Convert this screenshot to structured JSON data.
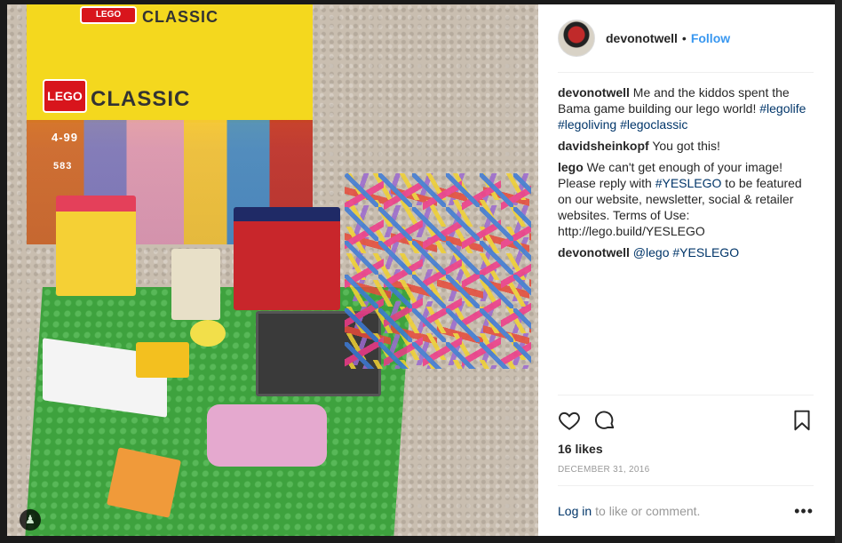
{
  "header": {
    "username": "devonotwell",
    "separator": "•",
    "follow_label": "Follow"
  },
  "photo": {
    "box_brand": "LEGO",
    "box_title": "CLASSIC",
    "box_age": "4-99",
    "box_count": "583",
    "user_icon": "person-tag-icon"
  },
  "comments": [
    {
      "user": "devonotwell",
      "text": "Me and the kiddos spent the Bama game building our lego world! ",
      "tags": [
        "#legolife",
        "#legoliving",
        "#legoclassic"
      ]
    },
    {
      "user": "davidsheinkopf",
      "text": "You got this!"
    },
    {
      "user": "lego",
      "text_before": "We can't get enough of your image! Please reply with ",
      "tag": "#YESLEGO",
      "text_after": " to be featured on our website, newsletter, social & retailer websites. Terms of Use: http://lego.build/YESLEGO"
    },
    {
      "user": "devonotwell",
      "mention": "@lego",
      "tag": "#YESLEGO"
    }
  ],
  "actions": {
    "icons": [
      "heart-icon",
      "comment-icon",
      "bookmark-icon"
    ],
    "likes": "16 likes",
    "date": "DECEMBER 31, 2016"
  },
  "footer": {
    "login_link": "Log in",
    "login_text": "to like or comment.",
    "more": "•••"
  }
}
